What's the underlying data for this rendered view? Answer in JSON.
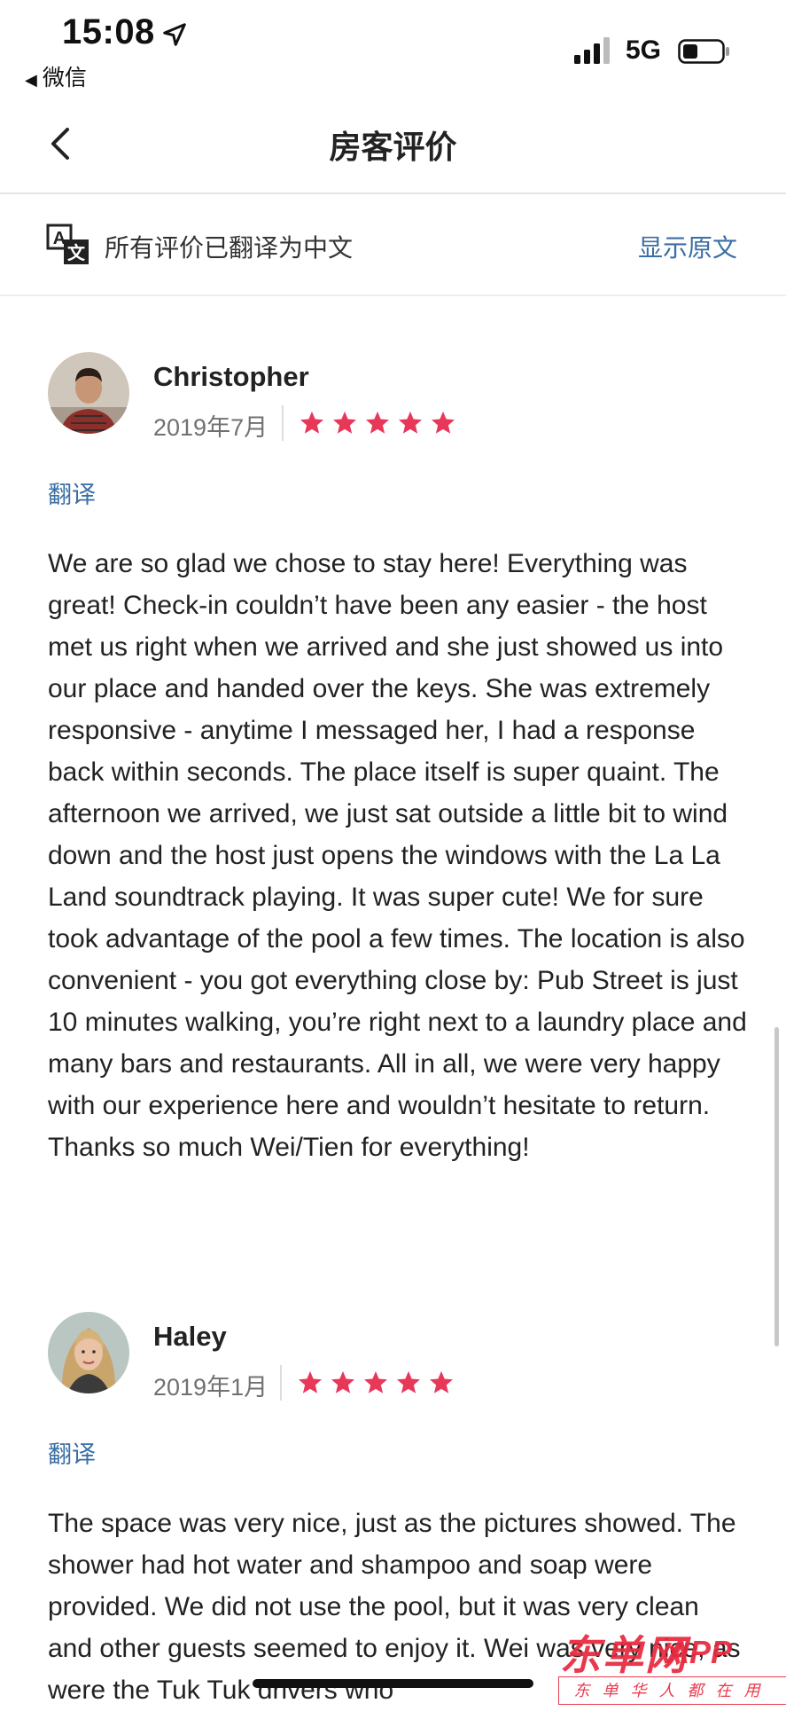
{
  "status_bar": {
    "time": "15:08",
    "back_app": "微信",
    "network": "5G"
  },
  "nav": {
    "title": "房客评价"
  },
  "banner": {
    "text": "所有评价已翻译为中文",
    "show_original": "显示原文"
  },
  "colors": {
    "star": "#e8385a",
    "link": "#3a6ea5",
    "watermark": "#e8283c"
  },
  "reviews": [
    {
      "name": "Christopher",
      "date": "2019年7月",
      "rating": 5,
      "translate_label": "翻译",
      "text": "We are so glad we chose to stay here! Everything was great! Check-in couldn’t have been any easier - the host met us right when we arrived and she just showed us into our place and handed over the keys. She was extremely responsive - anytime I messaged her, I had a response back within seconds. The place itself is super quaint. The afternoon we arrived, we just sat outside a little bit to wind down and the host just opens the windows with the La La Land soundtrack playing. It was super cute! We for sure took advantage of the pool a few times. The location is also convenient - you got everything close by: Pub Street is just 10 minutes walking, you’re right next to a laundry place and many bars and restaurants. All in all, we were very happy with our experience here and wouldn’t hesitate to return. Thanks so much Wei/Tien for everything!"
    },
    {
      "name": "Haley",
      "date": "2019年1月",
      "rating": 5,
      "translate_label": "翻译",
      "text": "The space was very nice, just as the pictures showed. The shower had hot water and shampoo and soap were provided. We did not use the pool, but it was very clean and other guests seemed to enjoy it. Wei was very nice, as were the Tuk Tuk drivers who"
    }
  ],
  "watermark": {
    "main": "东单网",
    "app": "APP",
    "sub": "东单华人都在用"
  }
}
